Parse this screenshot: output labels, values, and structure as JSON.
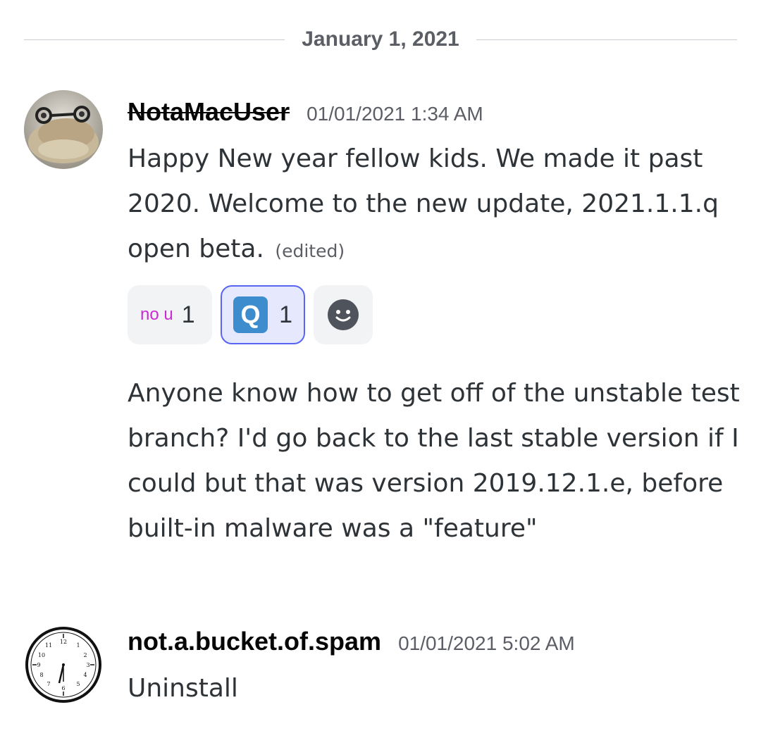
{
  "divider": {
    "date": "January 1, 2021"
  },
  "messages": [
    {
      "username": "NotaMacUser",
      "timestamp": "01/01/2021 1:34 AM",
      "text1": "Happy New year fellow kids. We made it past 2020. Welcome to the new update, 2021.1.1.q open beta.",
      "edited": "(edited)",
      "reactions": [
        {
          "label": "no u",
          "count": "1"
        },
        {
          "label": "Q",
          "count": "1"
        }
      ],
      "text2": "Anyone know how to get off of the unstable test branch? I'd go back to the last stable version if I could but that was version 2019.12.1.e, before built-in malware was a \"feature\""
    },
    {
      "username": "not.a.bucket.of.spam",
      "timestamp": "01/01/2021 5:02 AM",
      "text1": "Uninstall"
    }
  ],
  "colors": {
    "reaction_active_bg": "#e6e8fd",
    "reaction_active_border": "#5865f2",
    "nou_text": "#c92bd4",
    "q_box": "#3d8ccd"
  },
  "icons": [
    "avatar-gecko-glasses",
    "avatar-clock",
    "add-reaction-smile-icon"
  ]
}
